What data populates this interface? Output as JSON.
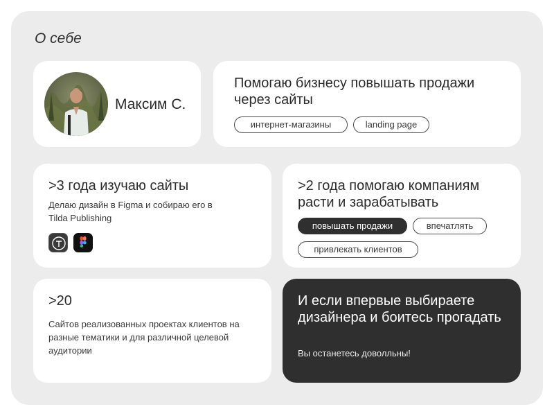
{
  "section": {
    "title": "О себе"
  },
  "profile": {
    "name": "Максим С."
  },
  "intro": {
    "headline": "Помогаю бизнесу повышать продажи через сайты",
    "tags": [
      "интернет-магазины",
      "landing page"
    ]
  },
  "experience": {
    "headline": ">3 года изучаю сайты",
    "description": "Делаю дизайн в Figma и собираю его в Tilda Publishing",
    "tools": [
      {
        "icon": "tilda-icon"
      },
      {
        "icon": "figma-icon"
      }
    ]
  },
  "help": {
    "headline": ">2 года помогаю компаниям расти и зарабатывать",
    "tags": [
      "повышать продажи",
      "впечатлять",
      "привлекать клиентов"
    ]
  },
  "projects": {
    "number": ">20",
    "description": "Сайтов реализованных проектах клиентов на разные тематики и для различной целевой аудитории"
  },
  "cta": {
    "headline": "И если впервые выбираете дизайнера и боитесь прогадать",
    "subtext": "Вы останетесь доволльны!"
  },
  "colors": {
    "panel_bg": "#ececec",
    "card_bg": "#ffffff",
    "dark": "#2f2f2f"
  }
}
